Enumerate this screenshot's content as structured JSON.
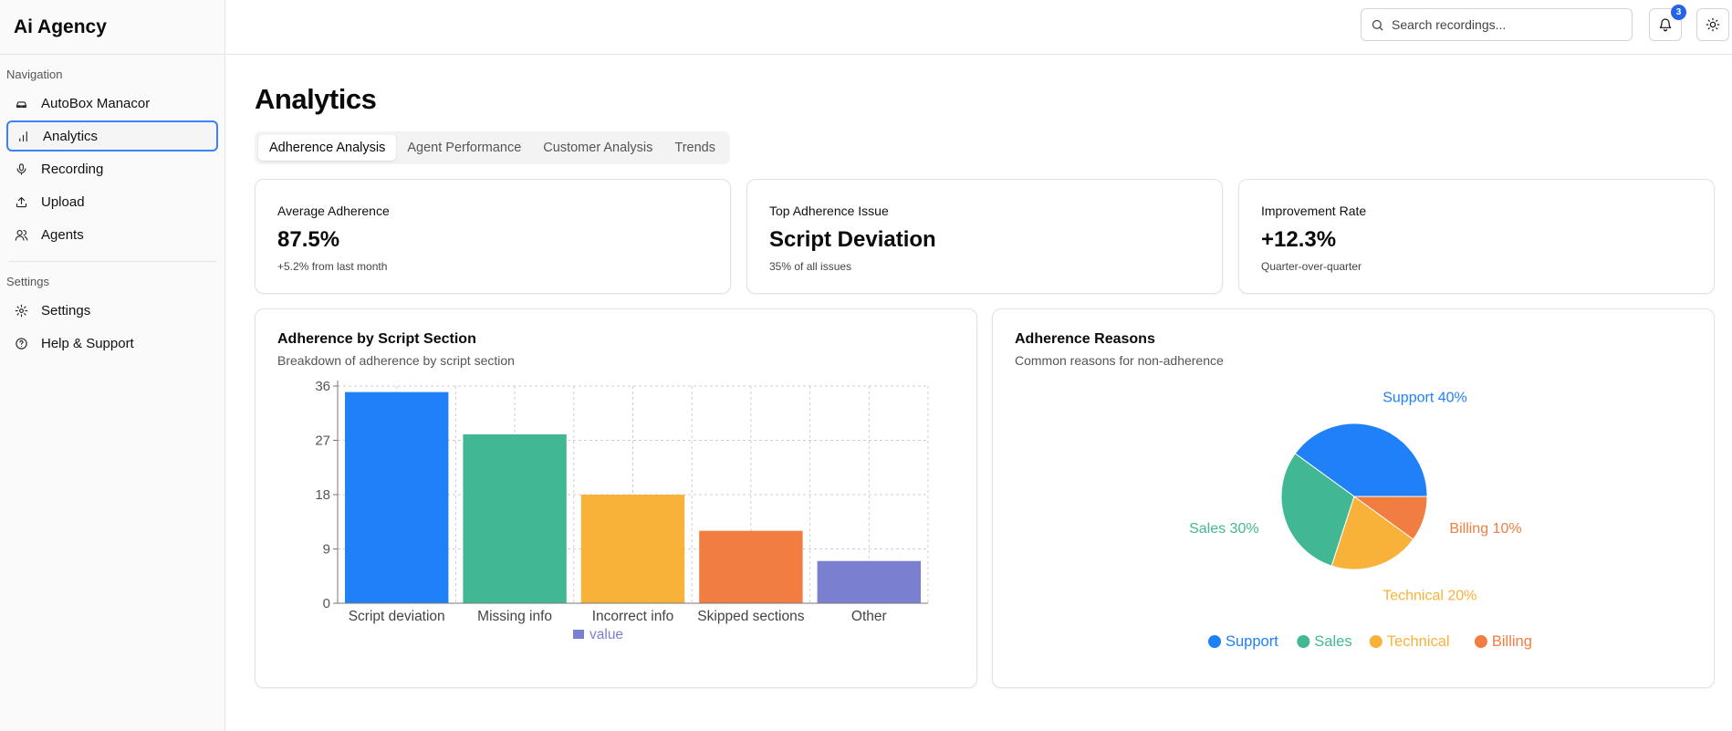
{
  "sidebar": {
    "brand": "Ai Agency",
    "nav_label": "Navigation",
    "nav_items": [
      {
        "label": "AutoBox Manacor",
        "icon": "car-icon"
      },
      {
        "label": "Analytics",
        "icon": "bar-chart-icon",
        "active": true
      },
      {
        "label": "Recording",
        "icon": "microphone-icon"
      },
      {
        "label": "Upload",
        "icon": "upload-icon"
      },
      {
        "label": "Agents",
        "icon": "users-icon"
      }
    ],
    "settings_label": "Settings",
    "settings_items": [
      {
        "label": "Settings",
        "icon": "gear-icon"
      },
      {
        "label": "Help & Support",
        "icon": "help-circle-icon"
      }
    ]
  },
  "topbar": {
    "search_placeholder": "Search recordings...",
    "notification_count": "3"
  },
  "main": {
    "title": "Analytics",
    "tabs": [
      "Adherence Analysis",
      "Agent Performance",
      "Customer Analysis",
      "Trends"
    ],
    "stats": [
      {
        "label": "Average Adherence",
        "value": "87.5%",
        "sub": "+5.2% from last month"
      },
      {
        "label": "Top Adherence Issue",
        "value": "Script Deviation",
        "sub": "35% of all issues"
      },
      {
        "label": "Improvement Rate",
        "value": "+12.3%",
        "sub": "Quarter-over-quarter"
      }
    ],
    "bar_card": {
      "title": "Adherence by Script Section",
      "subtitle": "Breakdown of adherence by script section"
    },
    "pie_card": {
      "title": "Adherence Reasons",
      "subtitle": "Common reasons for non-adherence"
    }
  },
  "colors": {
    "blue": "#1f80f8",
    "green": "#41b893",
    "yellow": "#f8b23a",
    "orange": "#f27d41",
    "purple": "#7b7fd0"
  },
  "chart_data": [
    {
      "type": "bar",
      "title": "Adherence by Script Section",
      "categories": [
        "Script deviation",
        "Missing info",
        "Incorrect info",
        "Skipped sections",
        "Other"
      ],
      "series": [
        {
          "name": "value",
          "values": [
            35,
            28,
            18,
            12,
            7
          ]
        }
      ],
      "yticks": [
        0,
        9,
        18,
        27,
        36
      ],
      "ylim": [
        0,
        36
      ],
      "grid": true,
      "legend": "bottom",
      "bar_colors": [
        "#1f80f8",
        "#41b893",
        "#f8b23a",
        "#f27d41",
        "#7b7fd0"
      ]
    },
    {
      "type": "pie",
      "title": "Adherence Reasons",
      "slices": [
        {
          "name": "Support",
          "value": 40,
          "label": "Support 40%",
          "color": "#1f80f8"
        },
        {
          "name": "Sales",
          "value": 30,
          "label": "Sales 30%",
          "color": "#41b893"
        },
        {
          "name": "Technical",
          "value": 20,
          "label": "Technical 20%",
          "color": "#f8b23a"
        },
        {
          "name": "Billing",
          "value": 10,
          "label": "Billing 10%",
          "color": "#f27d41"
        }
      ],
      "legend": "bottom"
    }
  ]
}
